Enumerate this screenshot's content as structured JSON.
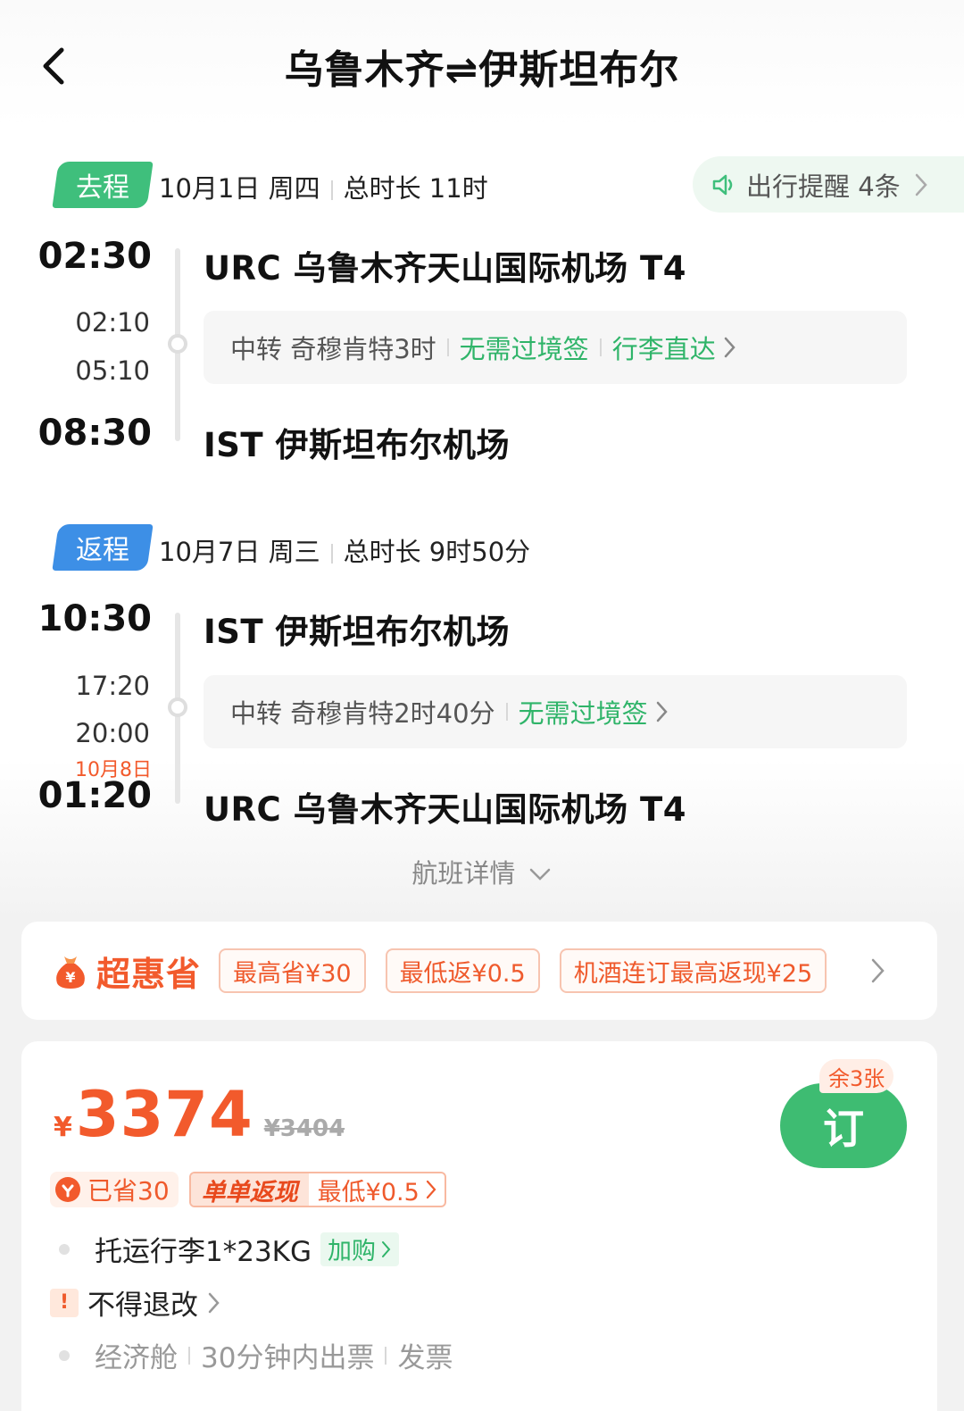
{
  "header": {
    "title": "乌鲁木齐⇌伊斯坦布尔"
  },
  "outbound": {
    "tag": "去程",
    "date": "10月1日 周四",
    "duration": "总时长 11时",
    "reminder": "出行提醒 4条",
    "depart_time": "02:30",
    "depart_airport": "URC 乌鲁木齐天山国际机场 T4",
    "transfer_arrive": "02:10",
    "transfer_depart": "05:10",
    "transfer_text": "中转 奇穆肯特3时",
    "transfer_visa": "无需过境签",
    "transfer_baggage": "行李直达",
    "arrive_time": "08:30",
    "arrive_airport": "IST 伊斯坦布尔机场"
  },
  "return": {
    "tag": "返程",
    "date": "10月7日 周三",
    "duration": "总时长 9时50分",
    "depart_time": "10:30",
    "depart_airport": "IST 伊斯坦布尔机场",
    "transfer_arrive": "17:20",
    "transfer_depart": "20:00",
    "transfer_text": "中转 奇穆肯特2时40分",
    "transfer_visa": "无需过境签",
    "arrive_date_note": "10月8日",
    "arrive_time": "01:20",
    "arrive_airport": "URC 乌鲁木齐天山国际机场 T4"
  },
  "details_link": "航班详情",
  "promo": {
    "brand": "超惠省",
    "coupons": [
      "最高省¥30",
      "最低返¥0.5",
      "机酒连订最高返现¥25"
    ]
  },
  "offer": {
    "currency": "¥",
    "price": "3374",
    "original_price": "¥3404",
    "remaining": "余3张",
    "book_label": "订",
    "saved": "已省30",
    "cashback_tag": "单单返现",
    "cashback_value": "最低¥0.5",
    "baggage": "托运行李1*23KG",
    "baggage_addon": "加购",
    "refund_policy": "不得退改",
    "cabin": "经济舱",
    "ticketing": "30分钟内出票",
    "invoice": "发票"
  },
  "colors": {
    "green": "#3fbf7c",
    "blue": "#3d8fe6",
    "orange": "#f25a2c"
  }
}
